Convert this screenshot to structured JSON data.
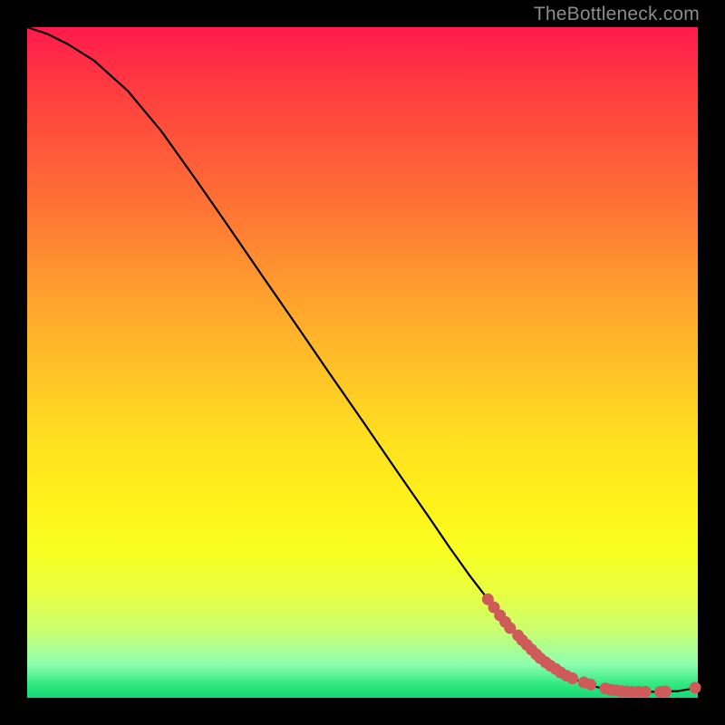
{
  "watermark": "TheBottleneck.com",
  "chart_data": {
    "type": "line",
    "title": "",
    "xlabel": "",
    "ylabel": "",
    "xlim": [
      0,
      100
    ],
    "ylim": [
      0,
      100
    ],
    "grid": false,
    "series": [
      {
        "name": "curve",
        "x": [
          0,
          3,
          6,
          10,
          15,
          20,
          25,
          30,
          35,
          40,
          45,
          50,
          55,
          60,
          63,
          66,
          70,
          74,
          78,
          82,
          85,
          87,
          89,
          91,
          94,
          97,
          100
        ],
        "y": [
          100,
          99,
          97.5,
          95,
          90.5,
          84.5,
          77.5,
          70.3,
          63,
          55.8,
          48.5,
          41.3,
          34,
          26.8,
          22.4,
          18.2,
          13,
          8.4,
          5.0,
          2.6,
          1.6,
          1.2,
          1.0,
          0.9,
          0.9,
          1.0,
          1.5
        ]
      }
    ],
    "markers": [
      {
        "x": 68.7,
        "y": 14.7
      },
      {
        "x": 69.6,
        "y": 13.5
      },
      {
        "x": 70.5,
        "y": 12.3
      },
      {
        "x": 71.3,
        "y": 11.3
      },
      {
        "x": 72.0,
        "y": 10.4
      },
      {
        "x": 73.2,
        "y": 9.3
      },
      {
        "x": 73.8,
        "y": 8.6
      },
      {
        "x": 74.5,
        "y": 7.9
      },
      {
        "x": 75.2,
        "y": 7.2
      },
      {
        "x": 75.9,
        "y": 6.5
      },
      {
        "x": 76.5,
        "y": 5.9
      },
      {
        "x": 77.3,
        "y": 5.3
      },
      {
        "x": 78.0,
        "y": 4.8
      },
      {
        "x": 78.8,
        "y": 4.3
      },
      {
        "x": 79.5,
        "y": 3.8
      },
      {
        "x": 80.4,
        "y": 3.3
      },
      {
        "x": 81.3,
        "y": 2.9
      },
      {
        "x": 83.0,
        "y": 2.3
      },
      {
        "x": 84.0,
        "y": 2.0
      },
      {
        "x": 86.2,
        "y": 1.4
      },
      {
        "x": 87.0,
        "y": 1.2
      },
      {
        "x": 87.8,
        "y": 1.1
      },
      {
        "x": 88.6,
        "y": 1.0
      },
      {
        "x": 89.4,
        "y": 0.95
      },
      {
        "x": 90.2,
        "y": 0.9
      },
      {
        "x": 91.2,
        "y": 0.9
      },
      {
        "x": 92.2,
        "y": 0.9
      },
      {
        "x": 94.4,
        "y": 0.9
      },
      {
        "x": 95.2,
        "y": 0.95
      },
      {
        "x": 99.6,
        "y": 1.5
      }
    ],
    "marker_color": "#cf5a5a",
    "curve_color": "#000000"
  }
}
